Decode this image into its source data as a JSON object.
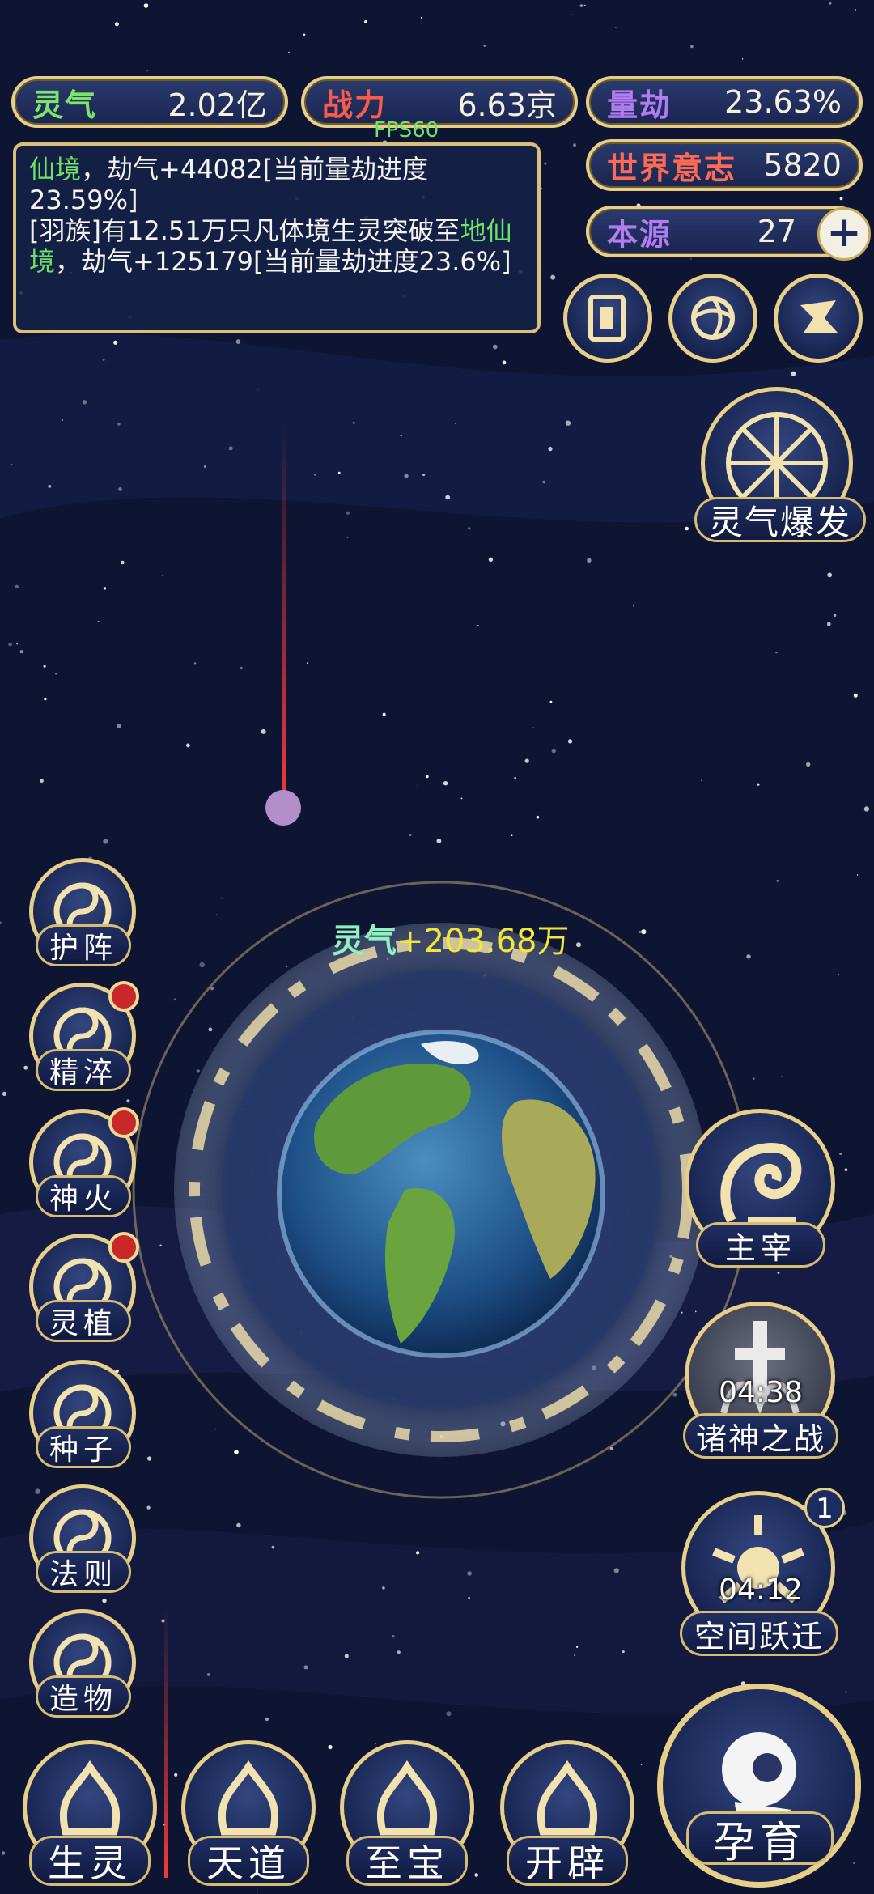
{
  "stats": {
    "lingqi": {
      "label": "灵气",
      "value": "2.02亿"
    },
    "zhanli": {
      "label": "战力",
      "value": "6.63京"
    },
    "liangjie": {
      "label": "量劫",
      "value": "23.63%"
    },
    "shijie": {
      "label": "世界意志",
      "value": "5820"
    },
    "benyuan": {
      "label": "本源",
      "value": "27",
      "plus": "+"
    }
  },
  "fps": "FPS60",
  "log": {
    "line1_green": "仙境",
    "line1_rest": "，劫气+44082[当前量劫进度23.59%]",
    "line2_pre": "[羽族]有12.51万只凡体境生灵突破至",
    "line2_green": "地仙境",
    "line2_rest": "，劫气+125179[当前量劫进度23.6%]"
  },
  "burst": {
    "label": "灵气爆发"
  },
  "gain": {
    "label": "灵气",
    "value": "+203.68万"
  },
  "left_menu": [
    {
      "label": "护阵",
      "icon": "taiji-icon",
      "dot": false
    },
    {
      "label": "精淬",
      "icon": "lotus-icon",
      "dot": true
    },
    {
      "label": "神火",
      "icon": "flame-icon",
      "dot": true
    },
    {
      "label": "灵植",
      "icon": "plant-icon",
      "dot": true
    },
    {
      "label": "种子",
      "icon": "flower-icon",
      "dot": false
    },
    {
      "label": "法则",
      "icon": "rune-icon",
      "dot": false
    },
    {
      "label": "造物",
      "icon": "diamond-icon",
      "dot": false
    }
  ],
  "right_menu": {
    "zhuzai": {
      "label": "主宰"
    },
    "zhushen": {
      "label": "诸神之战",
      "timer": "04:38"
    },
    "kongjian": {
      "label": "空间跃迁",
      "timer": "04:12",
      "badge": "1"
    }
  },
  "bottom_menu": [
    {
      "label": "生灵"
    },
    {
      "label": "天道"
    },
    {
      "label": "至宝"
    },
    {
      "label": "开辟"
    }
  ],
  "yunyu": {
    "label": "孕育"
  },
  "colors": {
    "gold": "#e7cf8a",
    "panel": "#1a2550",
    "green": "#6ee36a",
    "yellow": "#f2e63a",
    "red": "#c9282b"
  }
}
